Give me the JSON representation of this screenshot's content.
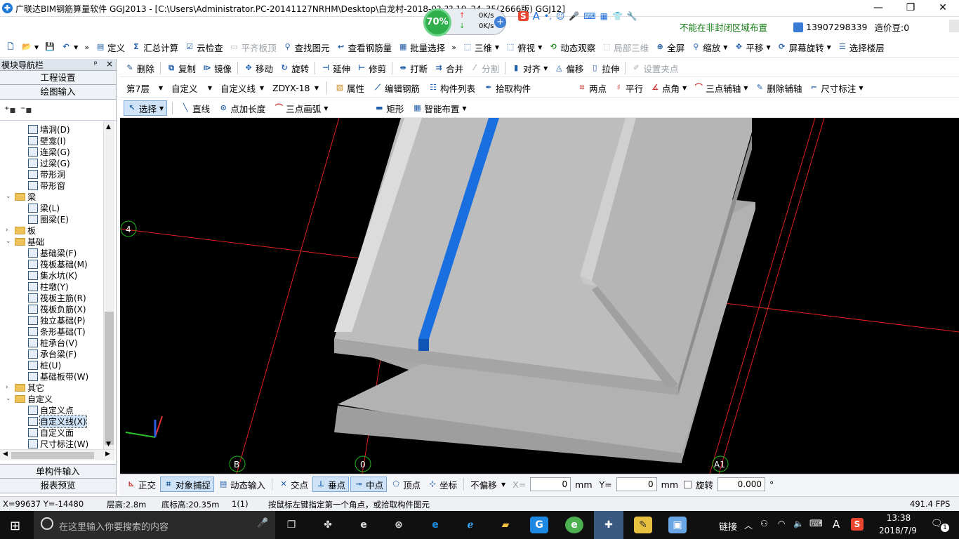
{
  "window": {
    "title": "广联达BIM钢筋算量软件 GGJ2013 - [C:\\Users\\Administrator.PC-20141127NRHM\\Desktop\\白龙村-2018-0?-?? 19_24_35(2666版) GGJ12]",
    "notice": "不能在非封闭区域布置",
    "phone": "13907298339",
    "price_bean": "造价豆:0",
    "minimize": "—",
    "restore": "❐",
    "close": "✕"
  },
  "speed_widget": {
    "percent": "70%",
    "up": "0K/s",
    "down": "0K/s"
  },
  "toolbar1": {
    "items": [
      "定义",
      "汇总计算",
      "云检查",
      "平齐板顶",
      "查找图元",
      "查看钢筋量",
      "批量选择",
      "三维",
      "俯视",
      "动态观察",
      "局部三维",
      "全屏",
      "缩放",
      "平移",
      "屏幕旋转",
      "选择楼层"
    ]
  },
  "toolbar2": {
    "items": [
      "删除",
      "复制",
      "镜像",
      "移动",
      "旋转",
      "延伸",
      "修剪",
      "打断",
      "合并",
      "分割",
      "对齐",
      "偏移",
      "拉伸",
      "设置夹点"
    ]
  },
  "toolbar3": {
    "floor": "第7层",
    "category": "自定义",
    "type": "自定义线",
    "component": "ZDYX-18",
    "items": [
      "属性",
      "编辑钢筋",
      "构件列表",
      "拾取构件"
    ],
    "axis_items": [
      "两点",
      "平行",
      "点角",
      "三点辅轴",
      "删除辅轴",
      "尺寸标注"
    ]
  },
  "toolbar4": {
    "items": [
      "选择",
      "直线",
      "点加长度",
      "三点画弧",
      "矩形",
      "智能布置"
    ]
  },
  "left_panel": {
    "title": "模块导航栏",
    "pin": "ᵖ",
    "close": "×",
    "btn_engineering": "工程设置",
    "btn_drawing": "绘图输入",
    "btn_single": "单构件输入",
    "btn_report": "报表预览",
    "tree": [
      {
        "label": "墙洞(D)",
        "level": 2
      },
      {
        "label": "壁龛(I)",
        "level": 2
      },
      {
        "label": "连梁(G)",
        "level": 2
      },
      {
        "label": "过梁(G)",
        "level": 2
      },
      {
        "label": "带形洞",
        "level": 2
      },
      {
        "label": "带形窗",
        "level": 2
      },
      {
        "label": "梁",
        "level": 1,
        "open": true
      },
      {
        "label": "梁(L)",
        "level": 2
      },
      {
        "label": "圈梁(E)",
        "level": 2
      },
      {
        "label": "板",
        "level": 1,
        "open": false
      },
      {
        "label": "基础",
        "level": 1,
        "open": true
      },
      {
        "label": "基础梁(F)",
        "level": 2
      },
      {
        "label": "筏板基础(M)",
        "level": 2
      },
      {
        "label": "集水坑(K)",
        "level": 2
      },
      {
        "label": "柱墩(Y)",
        "level": 2
      },
      {
        "label": "筏板主筋(R)",
        "level": 2
      },
      {
        "label": "筏板负筋(X)",
        "level": 2
      },
      {
        "label": "独立基础(P)",
        "level": 2
      },
      {
        "label": "条形基础(T)",
        "level": 2
      },
      {
        "label": "桩承台(V)",
        "level": 2
      },
      {
        "label": "承台梁(F)",
        "level": 2
      },
      {
        "label": "桩(U)",
        "level": 2
      },
      {
        "label": "基础板带(W)",
        "level": 2
      },
      {
        "label": "其它",
        "level": 1,
        "open": false
      },
      {
        "label": "自定义",
        "level": 1,
        "open": true
      },
      {
        "label": "自定义点",
        "level": 2
      },
      {
        "label": "自定义线(X)",
        "level": 2,
        "selected": true
      },
      {
        "label": "自定义面",
        "level": 2
      },
      {
        "label": "尺寸标注(W)",
        "level": 2
      }
    ]
  },
  "canvas": {
    "axis_labels": [
      "4",
      "B",
      "0",
      "A1"
    ]
  },
  "snapbar": {
    "items": [
      "正交",
      "对象捕捉",
      "动态输入",
      "交点",
      "垂点",
      "中点",
      "顶点",
      "坐标"
    ],
    "offset_mode": "不偏移",
    "x_label": "X=",
    "x_value": "0",
    "x_unit": "mm",
    "y_label": "Y=",
    "y_value": "0",
    "y_unit": "mm",
    "rotate_label": "旋转",
    "rotate_value": "0.000",
    "deg": "°"
  },
  "status": {
    "coords": "X=99637 Y=-14480",
    "floor_height": "层高:2.8m",
    "bottom_height": "底标高:20.35m",
    "count": "1(1)",
    "prompt": "按鼠标左键指定第一个角点，或拾取构件图元",
    "fps": "491.4 FPS"
  },
  "taskbar": {
    "search_placeholder": "在这里输入你要搜索的内容",
    "link": "链接",
    "time": "13:38",
    "date": "2018/7/9",
    "ime": "A",
    "notif": "1"
  }
}
